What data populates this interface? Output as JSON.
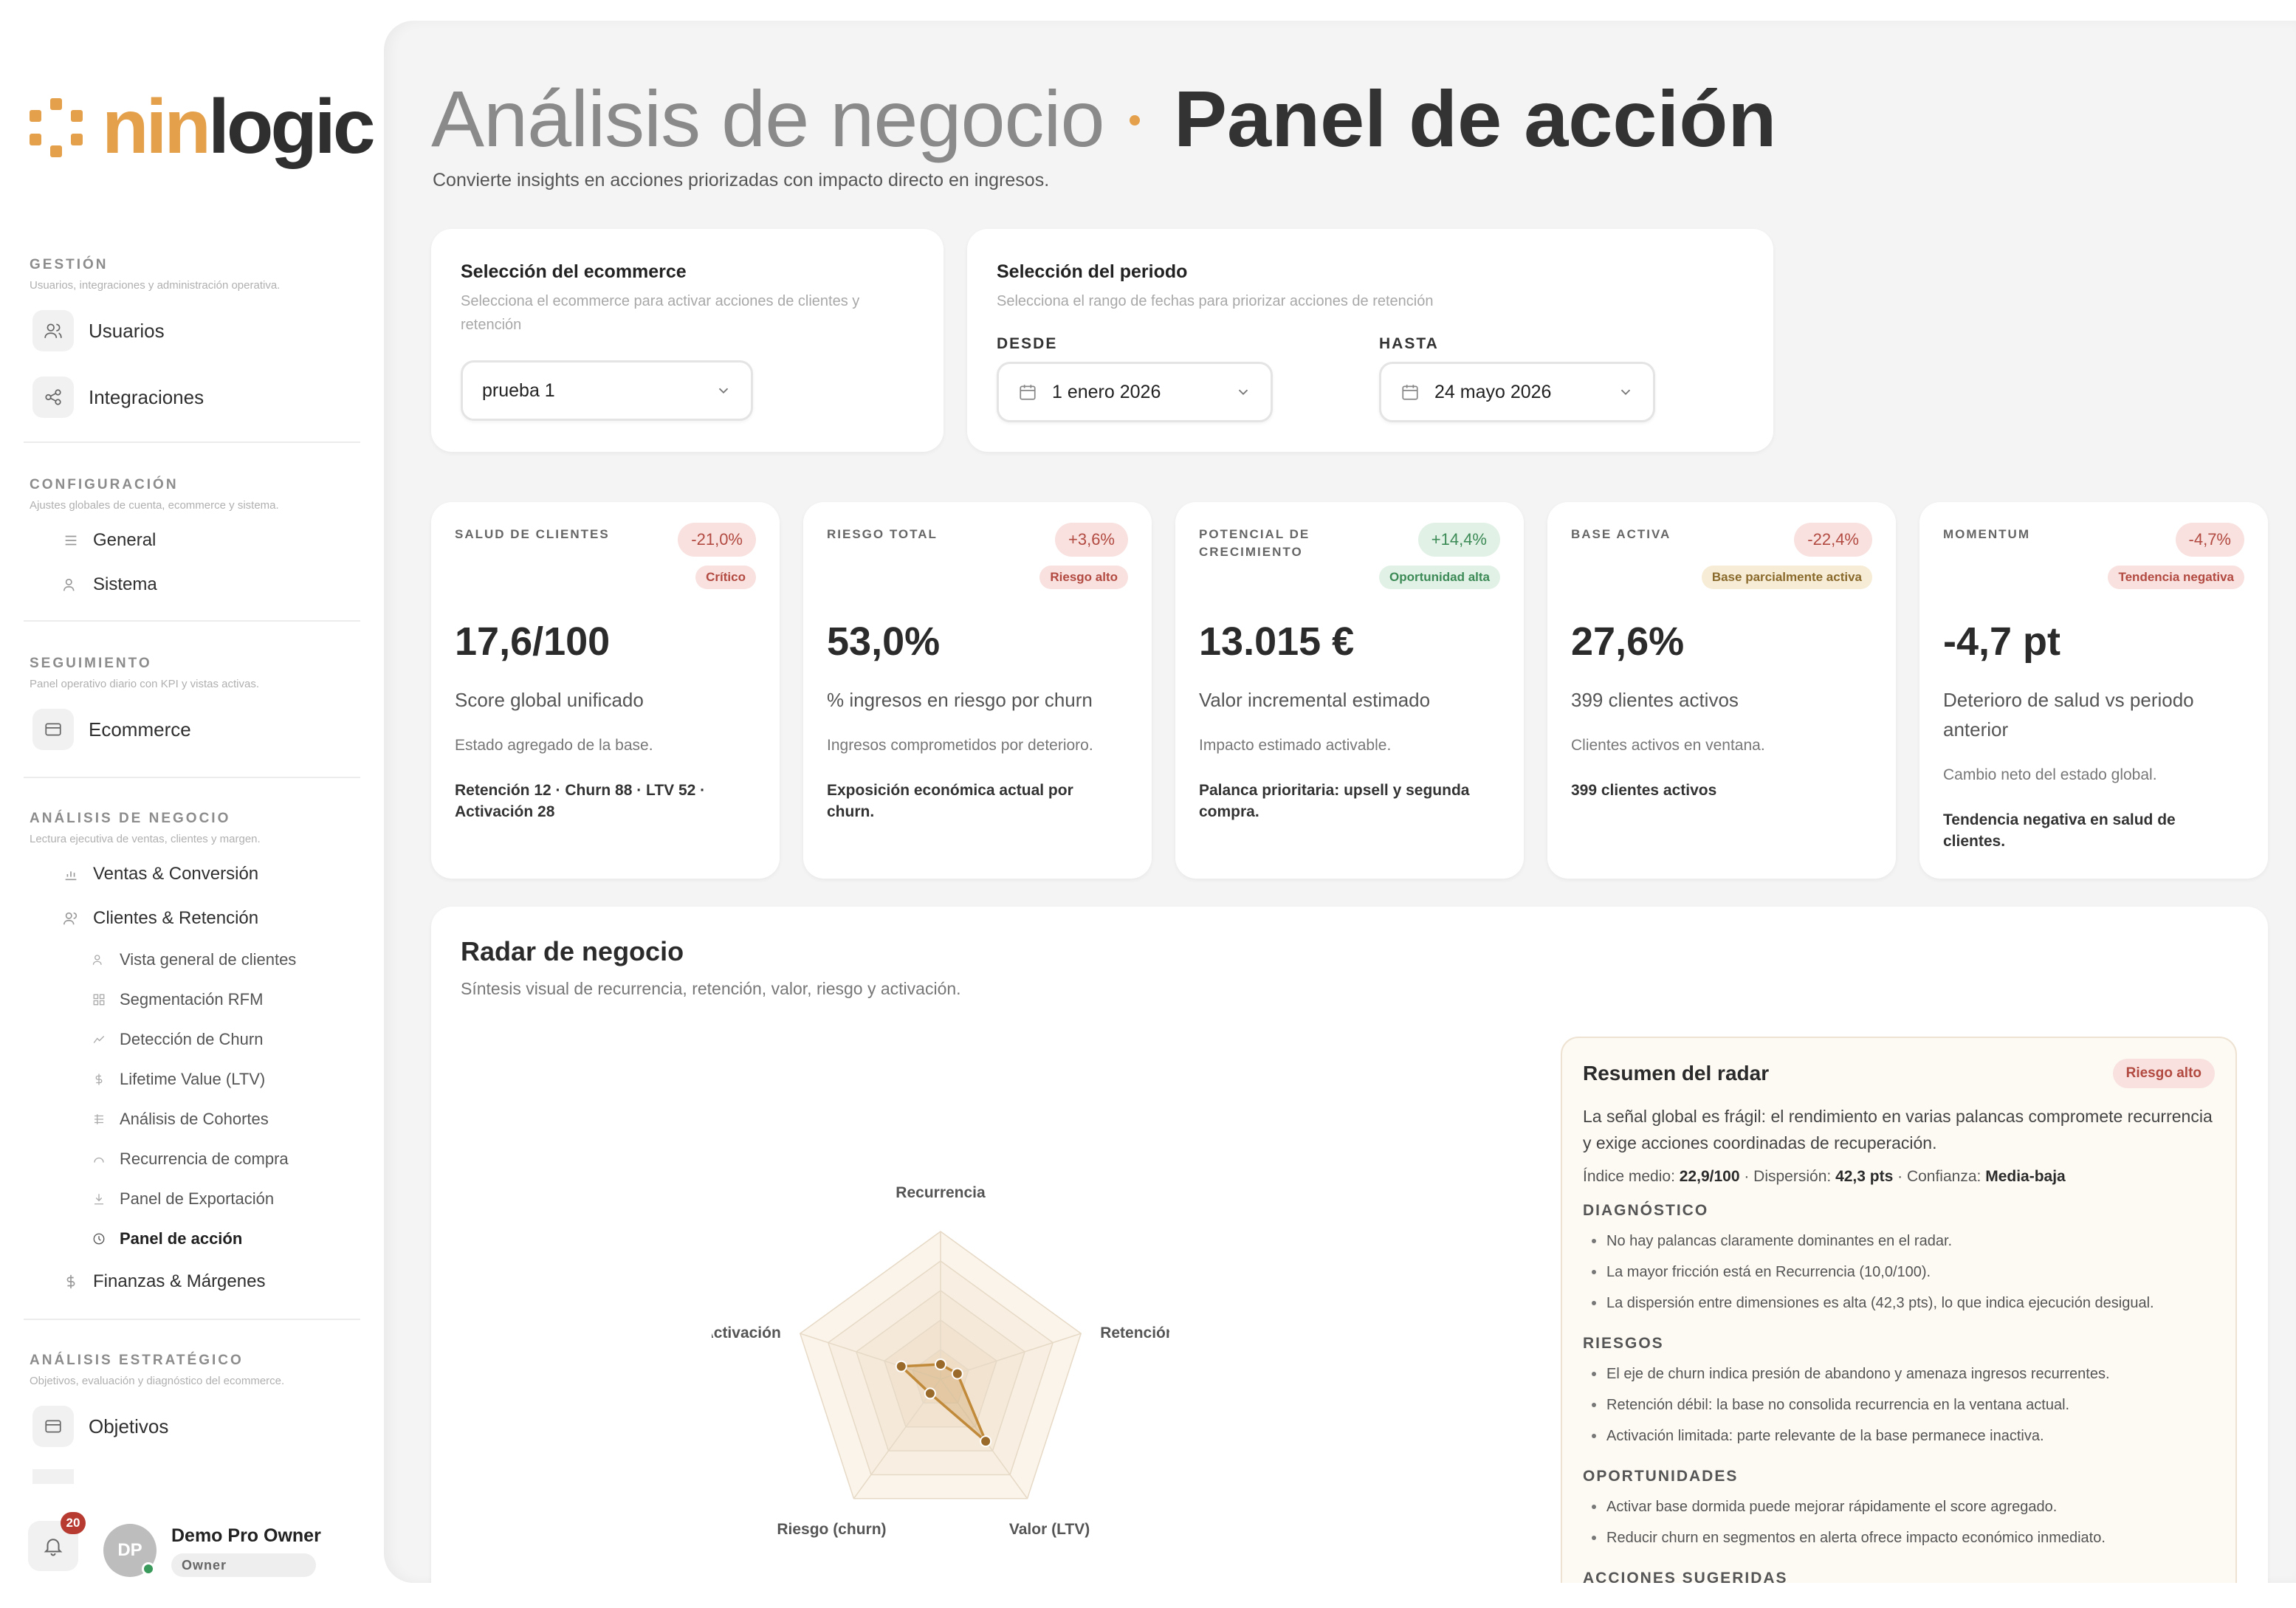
{
  "brand": {
    "name_part1": "nin",
    "name_part2": "logic",
    "accent": "#e4a04a"
  },
  "sidebar": {
    "sections": [
      {
        "title": "GESTIÓN",
        "subtitle": "Usuarios, integraciones y administración operativa."
      },
      {
        "title": "CONFIGURACIÓN",
        "subtitle": "Ajustes globales de cuenta, ecommerce y sistema."
      },
      {
        "title": "SEGUIMIENTO",
        "subtitle": "Panel operativo diario con KPI y vistas activas."
      },
      {
        "title": "ANÁLISIS DE NEGOCIO",
        "subtitle": "Lectura ejecutiva de ventas, clientes y margen."
      },
      {
        "title": "ANÁLISIS ESTRATÉGICO",
        "subtitle": "Objetivos, evaluación y diagnóstico del ecommerce."
      }
    ],
    "items": {
      "usuarios": "Usuarios",
      "integraciones": "Integraciones",
      "general": "General",
      "sistema": "Sistema",
      "ecommerce": "Ecommerce",
      "ventas": "Ventas & Conversión",
      "clientes": "Clientes & Retención",
      "vista_general": "Vista general de clientes",
      "segmentacion": "Segmentación RFM",
      "churn": "Detección de Churn",
      "ltv": "Lifetime Value (LTV)",
      "cohortes": "Análisis de Cohortes",
      "recurrencia": "Recurrencia de compra",
      "exportacion": "Panel de Exportación",
      "panel_accion": "Panel de acción",
      "finanzas": "Finanzas & Márgenes",
      "objetivos": "Objetivos"
    },
    "notifications_count": "20",
    "user": {
      "initials": "DP",
      "name": "Demo Pro Owner",
      "role": "Owner"
    }
  },
  "header": {
    "title_light": "Análisis de negocio",
    "title_bold": "Panel de acción",
    "subtitle": "Convierte insights en acciones priorizadas con impacto directo en ingresos."
  },
  "ecommerce_select": {
    "title": "Selección del ecommerce",
    "description": "Selecciona el ecommerce para activar acciones de clientes y retención",
    "value": "prueba 1"
  },
  "period_select": {
    "title": "Selección del periodo",
    "description": "Selecciona el rango de fechas para priorizar acciones de retención",
    "from_label": "DESDE",
    "from_value": "1 enero 2026",
    "to_label": "HASTA",
    "to_value": "24 mayo 2026"
  },
  "kpis": [
    {
      "label": "SALUD DE CLIENTES",
      "delta": "-21,0%",
      "tag": "Crítico",
      "value": "17,6/100",
      "description": "Score global unificado",
      "note": "Estado agregado de la base.",
      "detail": "Retención 12 · Churn 88 · LTV 52 · Activación 28"
    },
    {
      "label": "RIESGO TOTAL",
      "delta": "+3,6%",
      "tag": "Riesgo alto",
      "value": "53,0%",
      "description": "% ingresos en riesgo por churn",
      "note": "Ingresos comprometidos por deterioro.",
      "detail": "Exposición económica actual por churn."
    },
    {
      "label": "POTENCIAL DE CRECIMIENTO",
      "delta": "+14,4%",
      "tag": "Oportunidad alta",
      "value": "13.015 €",
      "description": "Valor incremental estimado",
      "note": "Impacto estimado activable.",
      "detail": "Palanca prioritaria: upsell y segunda compra."
    },
    {
      "label": "BASE ACTIVA",
      "delta": "-22,4%",
      "tag": "Base parcialmente activa",
      "value": "27,6%",
      "description": "399 clientes activos",
      "note": "Clientes activos en ventana.",
      "detail": "399 clientes activos"
    },
    {
      "label": "MOMENTUM",
      "delta": "-4,7%",
      "tag": "Tendencia negativa",
      "value": "-4,7 pt",
      "description": "Deterioro de salud vs periodo anterior",
      "note": "Cambio neto del estado global.",
      "detail": "Tendencia negativa en salud de clientes."
    }
  ],
  "radar": {
    "title": "Radar de negocio",
    "subtitle": "Síntesis visual de recurrencia, retención, valor, riesgo y activación.",
    "axes": [
      "Recurrencia",
      "Retención",
      "Valor (LTV)",
      "Riesgo (churn)",
      "Activación"
    ]
  },
  "chart_data": {
    "type": "radar",
    "categories": [
      "Recurrencia",
      "Retención",
      "Valor (LTV)",
      "Riesgo (churn)",
      "Activación"
    ],
    "values": [
      10,
      12,
      52,
      12,
      28
    ],
    "ylim": [
      0,
      100
    ],
    "grid": true,
    "color": "#c08a3a"
  },
  "summary": {
    "title": "Resumen del radar",
    "tag": "Riesgo alto",
    "lead": "La señal global es frágil: el rendimiento en varias palancas compromete recurrencia y exige acciones coordinadas de recuperación.",
    "metrics": {
      "mean_label": "Índice medio:",
      "mean_value": "22,9/100",
      "disp_label": "· Dispersión:",
      "disp_value": "42,3 pts",
      "conf_label": "· Confianza:",
      "conf_value": "Media-baja"
    },
    "diagnostico_title": "DIAGNÓSTICO",
    "diagnostico": [
      "No hay palancas claramente dominantes en el radar.",
      "La mayor fricción está en Recurrencia (10,0/100).",
      "La dispersión entre dimensiones es alta (42,3 pts), lo que indica ejecución desigual."
    ],
    "riesgos_title": "RIESGOS",
    "riesgos": [
      "El eje de churn indica presión de abandono y amenaza ingresos recurrentes.",
      "Retención débil: la base no consolida recurrencia en la ventana actual.",
      "Activación limitada: parte relevante de la base permanece inactiva."
    ],
    "oportunidades_title": "OPORTUNIDADES",
    "oportunidades": [
      "Activar base dormida puede mejorar rápidamente el score agregado.",
      "Reducir churn en segmentos en alerta ofrece impacto económico inmediato."
    ],
    "acciones_title": "ACCIONES SUGERIDAS"
  }
}
